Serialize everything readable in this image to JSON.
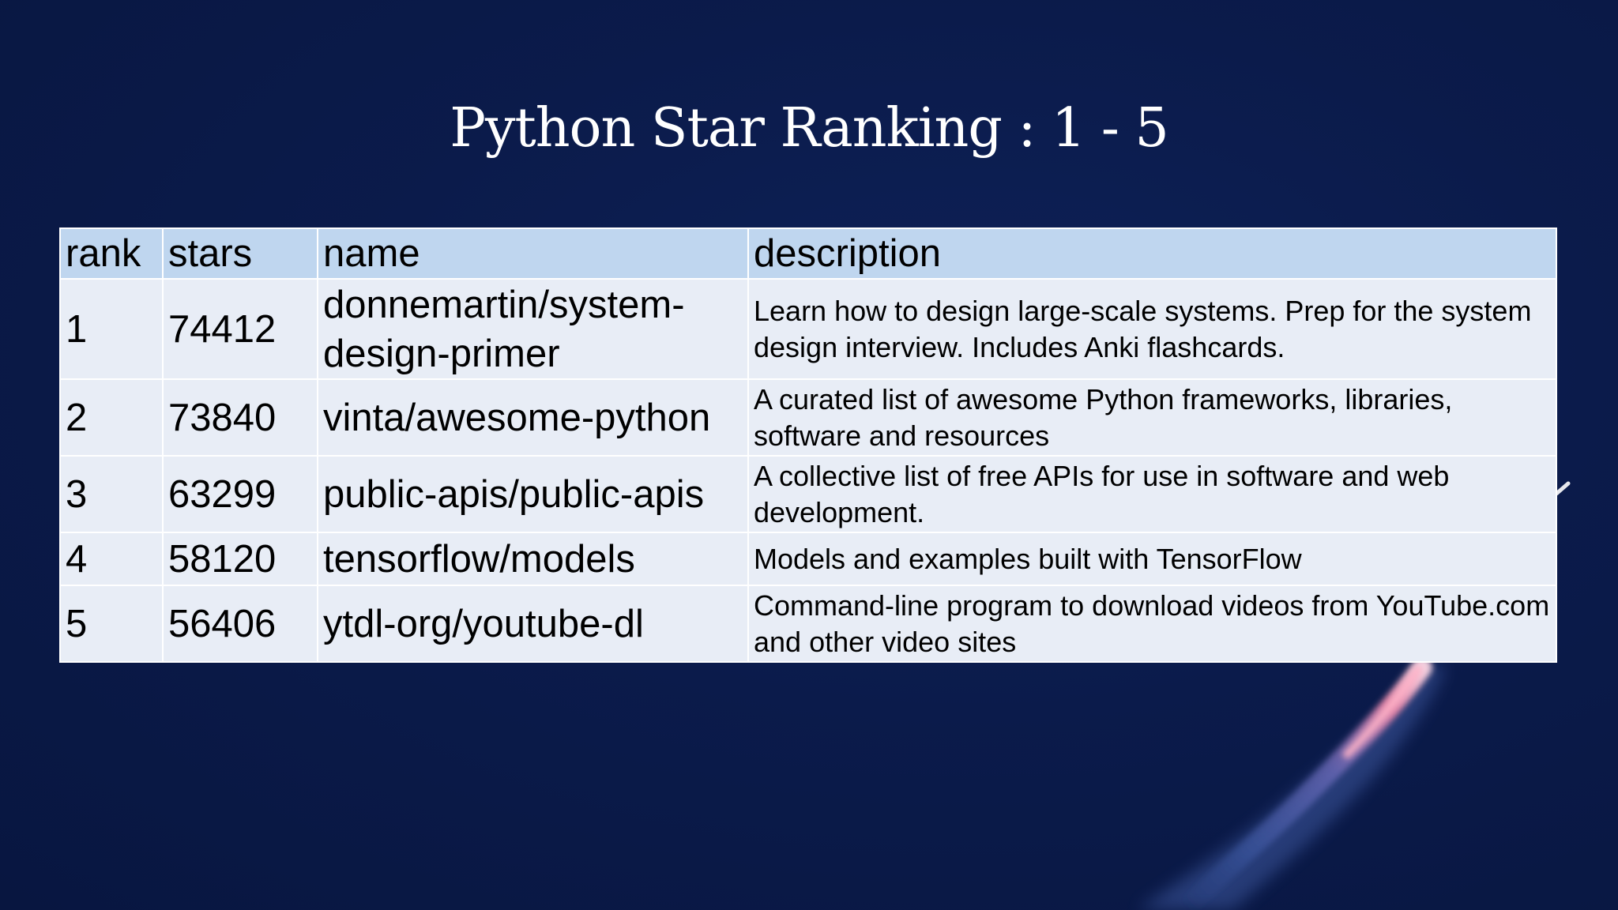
{
  "slide": {
    "title": "Python Star Ranking : 1 - 5"
  },
  "table": {
    "headers": {
      "rank": "rank",
      "stars": "stars",
      "name": "name",
      "description": "description"
    },
    "rows": [
      {
        "rank": "1",
        "stars": "74412",
        "name": "donnemartin/system-design-primer",
        "description": "Learn how to design large-scale systems. Prep for the system design interview. Includes Anki flashcards."
      },
      {
        "rank": "2",
        "stars": "73840",
        "name": "vinta/awesome-python",
        "description": "A curated list of awesome Python frameworks, libraries, software and resources"
      },
      {
        "rank": "3",
        "stars": "63299",
        "name": "public-apis/public-apis",
        "description": "A collective list of free APIs for use in software and web development."
      },
      {
        "rank": "4",
        "stars": "58120",
        "name": "tensorflow/models",
        "description": "Models and examples built with TensorFlow"
      },
      {
        "rank": "5",
        "stars": "56406",
        "name": "ytdl-org/youtube-dl",
        "description": "Command-line program to download videos from YouTube.com and other video sites"
      }
    ]
  },
  "colors": {
    "background": "#0a1a47",
    "header_fill": "#bfd6ef",
    "row_fill": "#e8edf6",
    "title_text": "#ffffff"
  }
}
